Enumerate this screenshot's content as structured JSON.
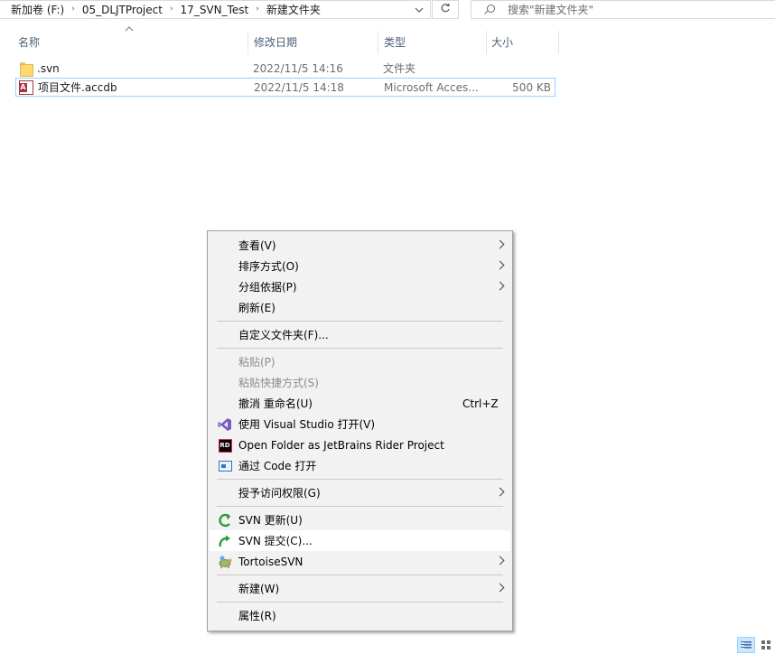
{
  "address_bar": {
    "crumbs": [
      "新加卷 (F:)",
      "05_DLJTProject",
      "17_SVN_Test",
      "新建文件夹"
    ],
    "separator": "›",
    "dropdown_icon": "chevron-down-icon",
    "refresh_icon": "refresh-icon"
  },
  "search": {
    "placeholder": "搜索\"新建文件夹\"",
    "icon": "search-icon"
  },
  "columns": {
    "name": "名称",
    "date": "修改日期",
    "type": "类型",
    "size": "大小"
  },
  "files": [
    {
      "name": ".svn",
      "date": "2022/11/5 14:16",
      "type": "文件夹",
      "size": "",
      "icon": "folder-icon"
    },
    {
      "name": "项目文件.accdb",
      "date": "2022/11/5 14:18",
      "type": "Microsoft Acces...",
      "size": "500 KB",
      "icon": "access-file-icon",
      "selected": true
    }
  ],
  "context_menu": {
    "items": [
      {
        "label": "查看(V)",
        "submenu": true
      },
      {
        "label": "排序方式(O)",
        "submenu": true
      },
      {
        "label": "分组依据(P)",
        "submenu": true
      },
      {
        "label": "刷新(E)"
      },
      {
        "label": "自定义文件夹(F)..."
      },
      {
        "label": "粘贴(P)",
        "disabled": true
      },
      {
        "label": "粘贴快捷方式(S)",
        "disabled": true
      },
      {
        "label": "撤消 重命名(U)",
        "shortcut": "Ctrl+Z"
      },
      {
        "label": "使用 Visual Studio 打开(V)",
        "icon": "visual-studio-icon"
      },
      {
        "label": "Open Folder as JetBrains Rider Project",
        "icon": "rider-icon",
        "icon_text": "RD"
      },
      {
        "label": "通过 Code 打开",
        "icon": "vscode-icon"
      },
      {
        "label": "授予访问权限(G)",
        "submenu": true
      },
      {
        "label": "SVN 更新(U)",
        "icon": "svn-update-icon"
      },
      {
        "label": "SVN 提交(C)...",
        "icon": "svn-commit-icon",
        "highlighted": true
      },
      {
        "label": "TortoiseSVN",
        "icon": "tortoisesvn-icon",
        "submenu": true
      },
      {
        "label": "新建(W)",
        "submenu": true
      },
      {
        "label": "属性(R)"
      }
    ]
  },
  "status_bar": {
    "view_buttons": [
      "details-view-icon",
      "large-icons-view-icon"
    ],
    "active_view": "details-view-icon"
  }
}
